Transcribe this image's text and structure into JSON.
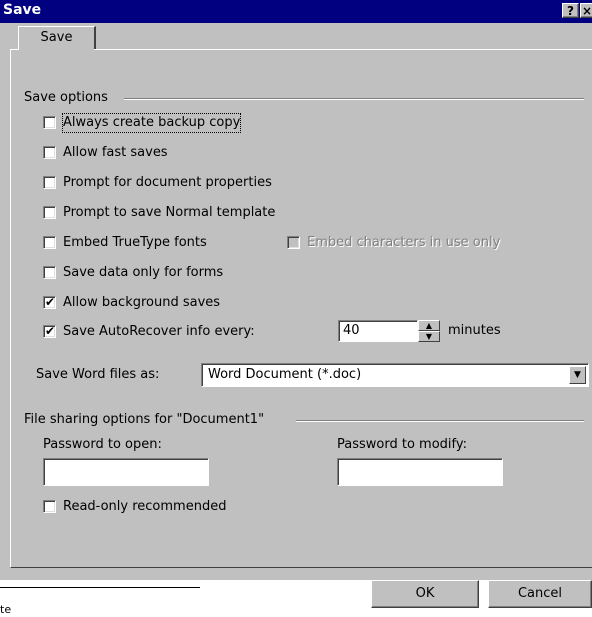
{
  "window": {
    "title": "Save",
    "help_glyph": "?",
    "close_glyph": "×"
  },
  "tab": {
    "label": "Save"
  },
  "save_options": {
    "group_label": "Save options",
    "checkboxes": [
      {
        "label": "Always create backup copy",
        "checked": false
      },
      {
        "label": "Allow fast saves",
        "checked": false
      },
      {
        "label": "Prompt for document properties",
        "checked": false
      },
      {
        "label": "Prompt to save Normal template",
        "checked": false
      },
      {
        "label": "Embed TrueType fonts",
        "checked": false
      },
      {
        "label": "Save data only for forms",
        "checked": false
      },
      {
        "label": "Allow background saves",
        "checked": true
      },
      {
        "label": "Save AutoRecover info every:",
        "checked": true
      }
    ],
    "embed_chars": {
      "label": "Embed characters in use only",
      "checked": false,
      "enabled": false
    },
    "autorecover_minutes": "40",
    "minutes_label": "minutes",
    "save_as_label": "Save Word files as:",
    "save_as_value": "Word Document (*.doc)"
  },
  "file_sharing": {
    "group_label": "File sharing options for \"Document1\"",
    "password_open_label": "Password to open:",
    "password_modify_label": "Password to modify:",
    "password_open_value": "",
    "password_modify_value": "",
    "read_only_label": "Read-only recommended"
  },
  "buttons": {
    "ok": "OK",
    "cancel": "Cancel"
  },
  "icons": {
    "checkmark": "✔",
    "spin_up": "▲",
    "spin_down": "▼",
    "dropdown": "▼"
  },
  "background_fragment": "te"
}
